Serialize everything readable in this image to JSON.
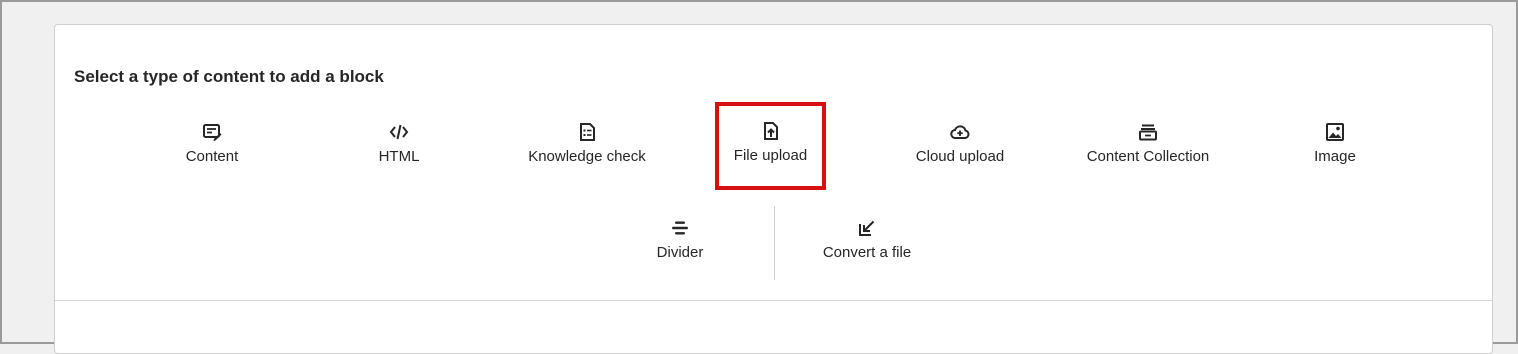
{
  "heading": "Select a type of content to add a block",
  "tiles": [
    {
      "label": "Content",
      "icon": "content-edit-icon"
    },
    {
      "label": "HTML",
      "icon": "code-icon"
    },
    {
      "label": "Knowledge check",
      "icon": "checklist-document-icon"
    },
    {
      "label": "File upload",
      "icon": "file-upload-icon"
    },
    {
      "label": "Cloud upload",
      "icon": "cloud-upload-icon"
    },
    {
      "label": "Content Collection",
      "icon": "archive-collection-icon"
    },
    {
      "label": "Image",
      "icon": "image-icon"
    }
  ],
  "secondary_tiles": [
    {
      "label": "Divider",
      "icon": "divider-icon"
    },
    {
      "label": "Convert a file",
      "icon": "convert-arrow-icon"
    }
  ],
  "colors": {
    "highlight": "#d60f0f",
    "text": "#262626",
    "panel": "#ffffff",
    "background": "#f0f0f0"
  }
}
